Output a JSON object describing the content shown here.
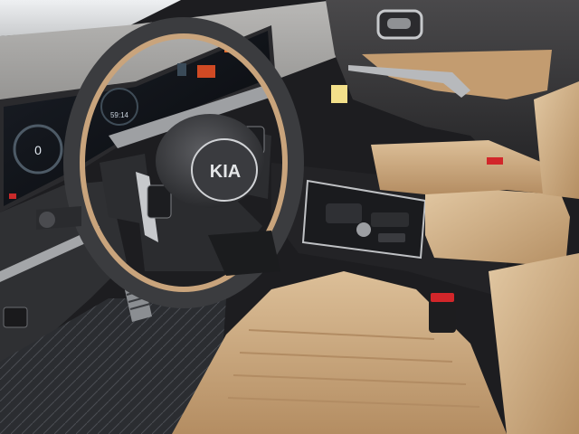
{
  "scene": {
    "subject": "car-interior-driver-side",
    "brand_logo_text": "KIA",
    "cluster": {
      "range_value": "0",
      "time_value": "59:14"
    },
    "colors": {
      "leather": "#c9a47c",
      "leather_dark": "#a98257",
      "trim_dark": "#2a2a2d",
      "screen": "#0e1014",
      "chrome": "#c7c9cc",
      "door_panel": "#3b3a3c",
      "seatbelt_tab": "#d2262a"
    }
  }
}
